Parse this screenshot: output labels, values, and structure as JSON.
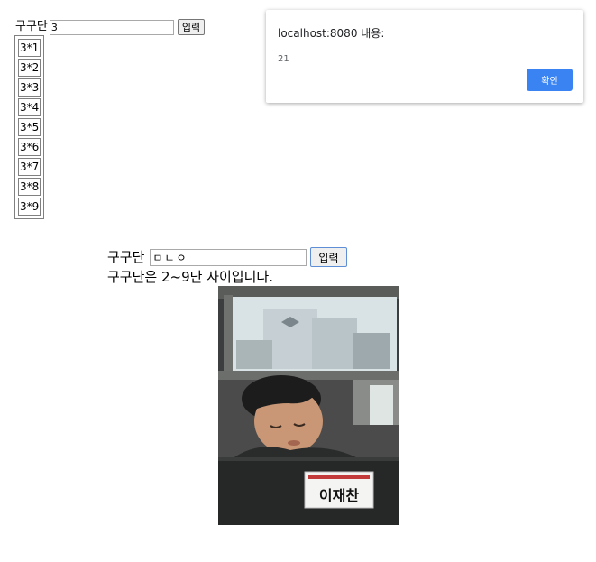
{
  "top_form": {
    "label": "구구단",
    "input_value": "3",
    "submit_label": "입력"
  },
  "results": [
    "3*1",
    "3*2",
    "3*3",
    "3*4",
    "3*5",
    "3*6",
    "3*7",
    "3*8",
    "3*9"
  ],
  "alert": {
    "title": "localhost:8080 내용:",
    "message": "21",
    "ok_label": "확인",
    "ok_color": "#3a83f2"
  },
  "form2": {
    "label": "구구단",
    "input_value": "ㅁㄴㅇ",
    "submit_label": "입력"
  },
  "notice": "구구단은 2~9단 사이입니다.",
  "photo": {
    "name_tag": "이재찬"
  }
}
